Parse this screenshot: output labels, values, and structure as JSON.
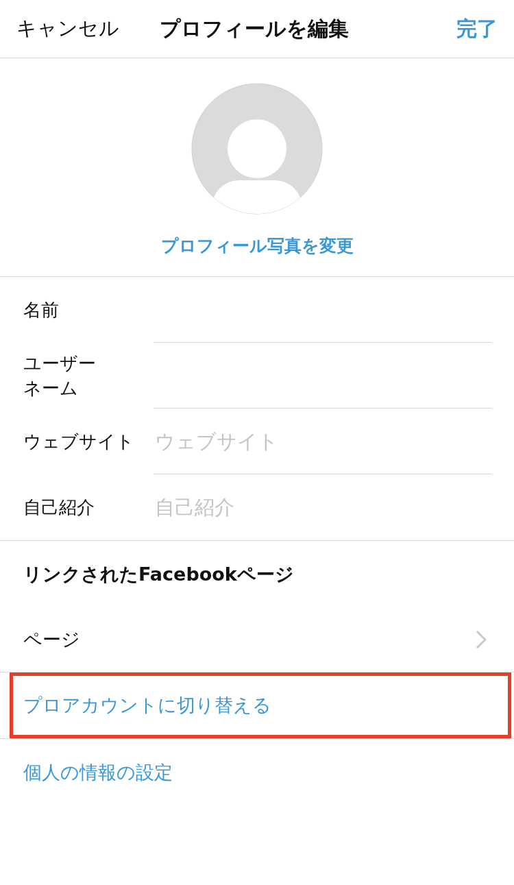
{
  "nav": {
    "cancel": "キャンセル",
    "title": "プロフィールを編集",
    "done": "完了"
  },
  "profile_photo": {
    "change_link": "プロフィール写真を変更"
  },
  "fields": [
    {
      "label": "名前"
    },
    {
      "label_lines": [
        "ユーザー",
        "ネーム"
      ]
    },
    {
      "label": "ウェブサイト",
      "placeholder": "ウェブサイト"
    },
    {
      "label": "自己紹介",
      "placeholder": "自己紹介"
    }
  ],
  "linked_section": {
    "title": "リンクされたFacebookページ",
    "rows": [
      {
        "label": "ページ"
      }
    ]
  },
  "links": [
    {
      "label": "プロアカウントに切り替える",
      "highlighted": true
    },
    {
      "label": "個人の情報の設定",
      "highlighted": false
    }
  ]
}
